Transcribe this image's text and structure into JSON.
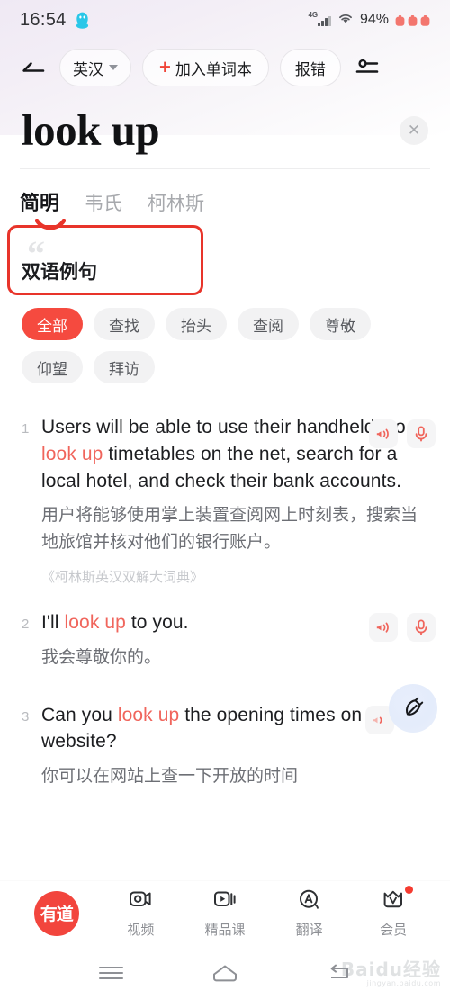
{
  "status_bar": {
    "time": "16:54",
    "qq_icon": "qq-penguin-icon",
    "network": "4G",
    "wifi_icon": "wifi-icon",
    "battery_percent": "94%",
    "extra_icons": [
      "battery-icon",
      "battery-icon",
      "battery-icon"
    ]
  },
  "action_bar": {
    "back_icon": "back-arrow-icon",
    "language_label": "英汉",
    "language_caret": "chevron-down-icon",
    "add_wordbook_plus": "+",
    "add_wordbook_label": "加入单词本",
    "report_label": "报错",
    "settings_icon": "sliders-icon"
  },
  "headword": {
    "word": "look up",
    "close_icon": "✕"
  },
  "dict_tabs": [
    {
      "label": "简明",
      "active": true
    },
    {
      "label": "韦氏",
      "active": false
    },
    {
      "label": "柯林斯",
      "active": false
    }
  ],
  "section": {
    "quote_glyph": "“",
    "title": "双语例句",
    "annotation_color": "#e8342a"
  },
  "chips": [
    {
      "label": "全部",
      "active": true
    },
    {
      "label": "查找",
      "active": false
    },
    {
      "label": "抬头",
      "active": false
    },
    {
      "label": "查阅",
      "active": false
    },
    {
      "label": "尊敬",
      "active": false
    },
    {
      "label": "仰望",
      "active": false
    },
    {
      "label": "拜访",
      "active": false
    }
  ],
  "examples": [
    {
      "num": "1",
      "en_pre": "Users will be able to use their handhelds to ",
      "en_kw": "look up",
      "en_post": " timetables on the net, search for a local hotel, and check their bank accounts.",
      "cn": "用户将能够使用掌上装置查阅网上时刻表，搜索当地旅馆并核对他们的银行账户。",
      "source": "《柯林斯英汉双解大词典》",
      "speaker_icon": "speaker-icon",
      "mic_icon": "microphone-icon"
    },
    {
      "num": "2",
      "en_pre": "I'll ",
      "en_kw": "look up",
      "en_post": " to you.",
      "cn": "我会尊敬你的。",
      "source": "",
      "speaker_icon": "speaker-icon",
      "mic_icon": "microphone-icon"
    },
    {
      "num": "3",
      "en_pre": "Can you ",
      "en_kw": "look up",
      "en_post": " the opening times on the website?",
      "cn": "你可以在网站上查一下开放的时间",
      "source": "",
      "speaker_icon": "speaker-icon",
      "mic_icon": "pen-nib-icon"
    }
  ],
  "bottom_nav": {
    "logo_label": "有道",
    "items": [
      {
        "label": "视频",
        "icon": "video-camera-icon",
        "badge": false
      },
      {
        "label": "精品课",
        "icon": "play-course-icon",
        "badge": false
      },
      {
        "label": "翻译",
        "icon": "translate-icon",
        "badge": false
      },
      {
        "label": "会员",
        "icon": "crown-member-icon",
        "badge": true
      }
    ]
  },
  "android_nav": {
    "menu_icon": "hamburger-menu-icon",
    "home_icon": "home-icon",
    "back_icon": "back-nav-icon"
  },
  "watermark": {
    "text": "Baidu经验",
    "sub": "jingyan.baidu.com"
  },
  "colors": {
    "accent_red": "#f54a3f",
    "keyword_red": "#f0655c",
    "annotation_red": "#e8342a",
    "gray_text": "#6d6f75"
  }
}
